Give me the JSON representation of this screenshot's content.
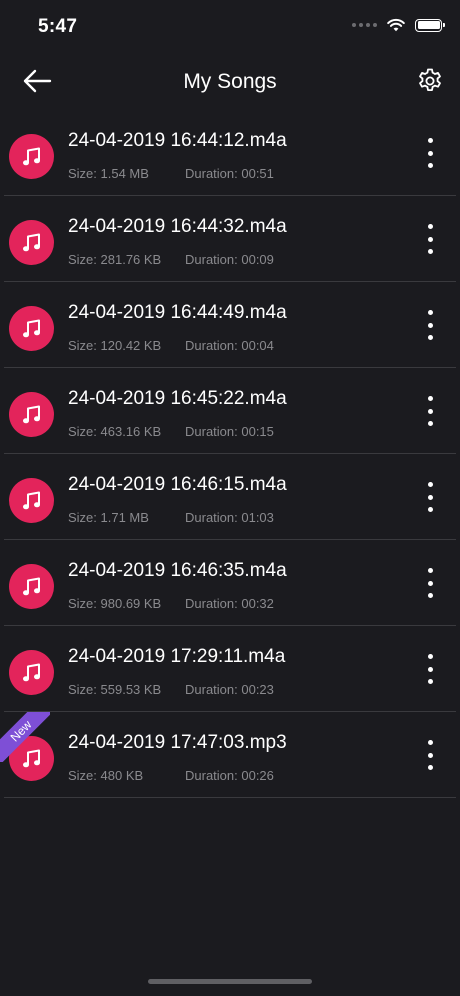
{
  "status_bar": {
    "time": "5:47",
    "icons": [
      "signal-dots-icon",
      "wifi-icon",
      "battery-icon"
    ]
  },
  "nav": {
    "title": "My Songs",
    "back_icon": "arrow-left-icon",
    "settings_icon": "gear-icon"
  },
  "song_icon": "music-note-icon",
  "accent_color": "#e3245b",
  "badge_color": "#7e4fd6",
  "songs": [
    {
      "title": "24-04-2019 16:44:12.m4a",
      "size": "Size: 1.54 MB",
      "duration": "Duration: 00:51"
    },
    {
      "title": "24-04-2019 16:44:32.m4a",
      "size": "Size: 281.76 KB",
      "duration": "Duration: 00:09"
    },
    {
      "title": "24-04-2019 16:44:49.m4a",
      "size": "Size: 120.42 KB",
      "duration": "Duration: 00:04"
    },
    {
      "title": "24-04-2019 16:45:22.m4a",
      "size": "Size: 463.16 KB",
      "duration": "Duration: 00:15"
    },
    {
      "title": "24-04-2019 16:46:15.m4a",
      "size": "Size: 1.71 MB",
      "duration": "Duration: 01:03"
    },
    {
      "title": "24-04-2019 16:46:35.m4a",
      "size": "Size: 980.69 KB",
      "duration": "Duration: 00:32"
    },
    {
      "title": "24-04-2019 17:29:11.m4a",
      "size": "Size: 559.53 KB",
      "duration": "Duration: 00:23"
    },
    {
      "title": "24-04-2019 17:47:03.mp3",
      "size": "Size: 480 KB",
      "duration": "Duration: 00:26",
      "badge": "New"
    }
  ]
}
